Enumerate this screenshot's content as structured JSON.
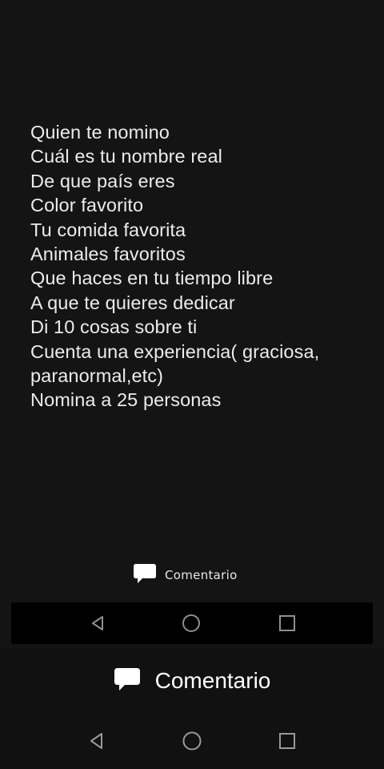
{
  "questions": [
    "Quien te nomino",
    "Cuál es tu nombre real",
    "De que país eres",
    "Color favorito",
    "Tu comida favorita",
    "Animales favoritos",
    "Que haces en tu tiempo libre",
    "A que te quieres dedicar",
    "Di 10 cosas sobre ti",
    "Cuenta una experiencia( graciosa,",
    "paranormal,etc)",
    "Nomina a 25 personas"
  ],
  "inner_comment": {
    "label": "Comentario",
    "icon": "comment-icon"
  },
  "outer_comment": {
    "label": "Comentario",
    "icon": "comment-icon"
  },
  "nav": {
    "icons": [
      "back-triangle-icon",
      "home-circle-icon",
      "recents-square-icon"
    ],
    "inner_color": "#8e8e8e",
    "outer_color": "#9a9a9a"
  }
}
